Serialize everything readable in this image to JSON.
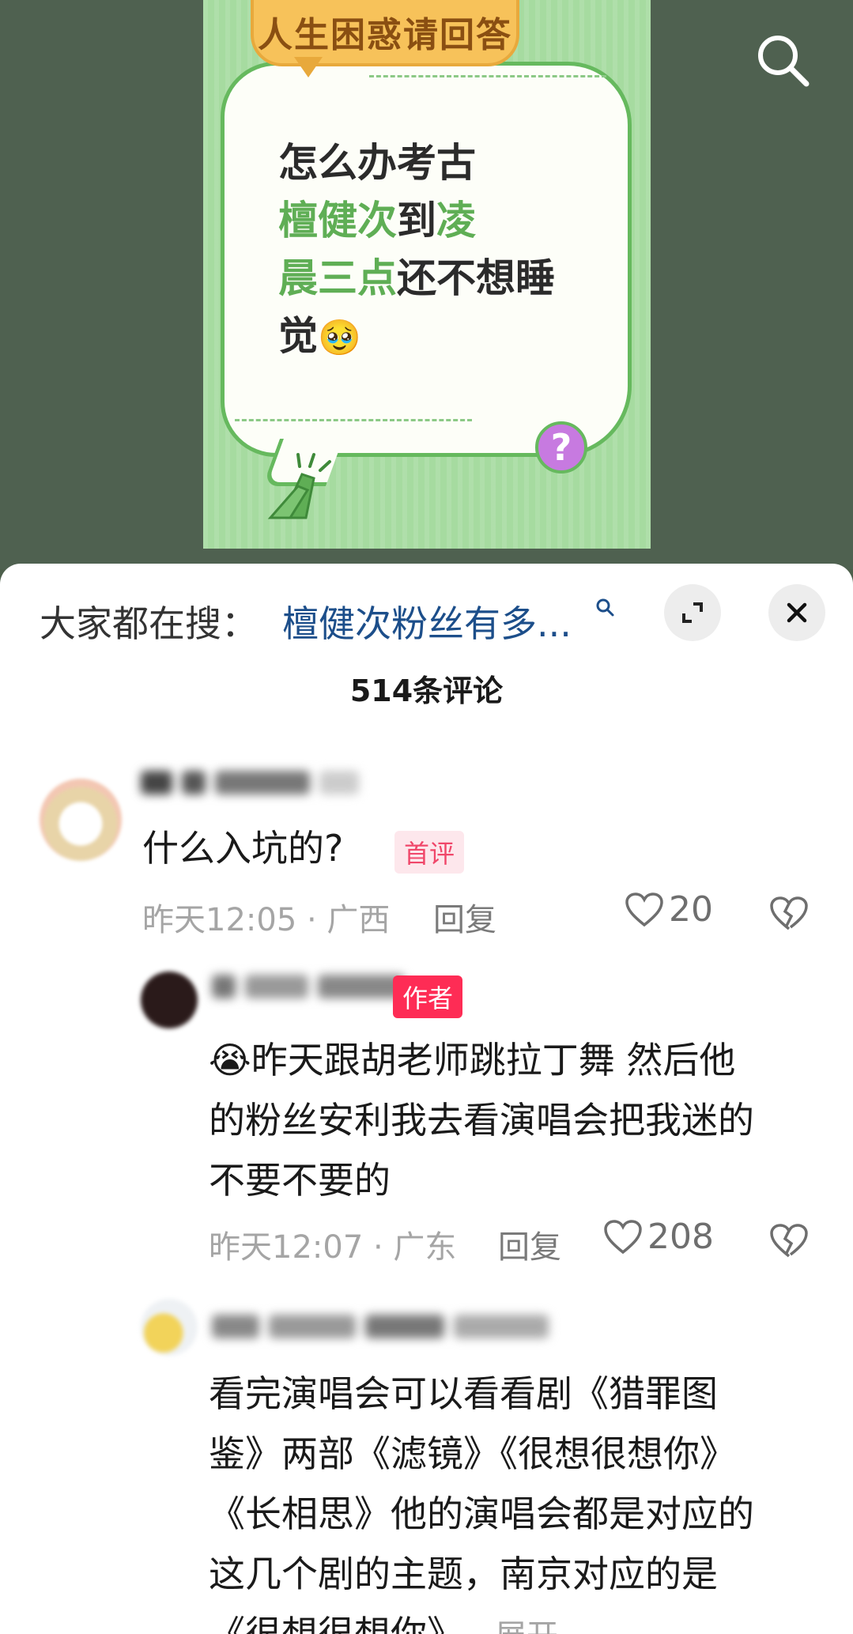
{
  "poster": {
    "banner": "人生困惑请回答",
    "line1": "怎么办考古",
    "line2_green": "檀健次",
    "line2_dark": "到",
    "line2_green2": "凌",
    "line3_green": "晨三点",
    "line3_dark": "还不想睡",
    "line4_dark": "觉",
    "emoji": "🥹",
    "question_mark": "?"
  },
  "search": {
    "prefix": "大家都在搜：",
    "query": "檀健次粉丝有多..."
  },
  "comment_count": "514条评论",
  "comments": [
    {
      "text": "什么入坑的?",
      "tag": "首评",
      "time_location": "昨天12:05 · 广西",
      "reply_label": "回复",
      "likes": "20"
    },
    {
      "tag": "作者",
      "emoji": "😭",
      "text_lines": [
        "昨天跟胡老师跳拉丁舞 然后他",
        "的粉丝安利我去看演唱会把我迷的",
        "不要不要的"
      ],
      "time_location": "昨天12:07 · 广东",
      "reply_label": "回复",
      "likes": "208"
    },
    {
      "text_lines": [
        "看完演唱会可以看看剧《猎罪图",
        "鉴》两部《滤镜》《很想很想你》",
        "《长相思》他的演唱会都是对应的",
        "这几个剧的主题，南京对应的是",
        "《很想很想你》"
      ],
      "expand_label": "展开"
    }
  ],
  "colors": {
    "accent_red": "#fe2c55",
    "query_blue": "#1c4e8a",
    "poster_green": "#a6dba0"
  }
}
